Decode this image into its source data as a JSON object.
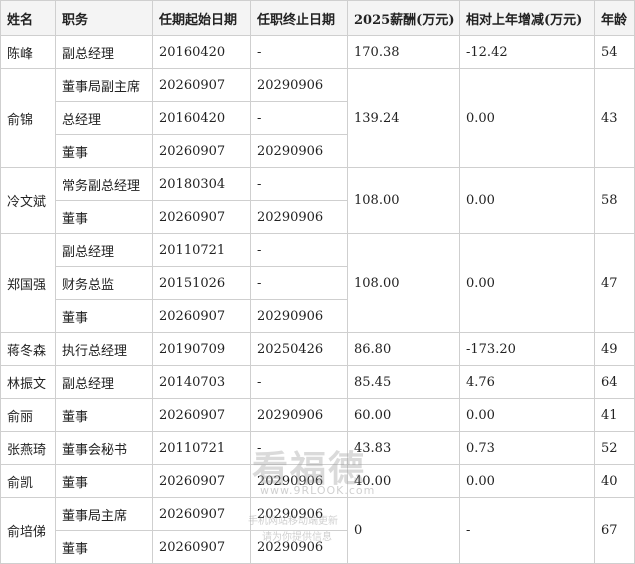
{
  "headers": [
    "姓名",
    "职务",
    "任期起始日期",
    "任职终止日期",
    "2025薪酬(万元)",
    "相对上年增减(万元)",
    "年龄"
  ],
  "people": [
    {
      "name": "陈峰",
      "roles": [
        {
          "title": "副总经理",
          "start": "20160420",
          "end": "-"
        }
      ],
      "salary": "170.38",
      "change": "-12.42",
      "age": "54"
    },
    {
      "name": "俞锦",
      "roles": [
        {
          "title": "董事局副主席",
          "start": "20260907",
          "end": "20290906"
        },
        {
          "title": "总经理",
          "start": "20160420",
          "end": "-"
        },
        {
          "title": "董事",
          "start": "20260907",
          "end": "20290906"
        }
      ],
      "salary": "139.24",
      "change": "0.00",
      "age": "43"
    },
    {
      "name": "冷文斌",
      "roles": [
        {
          "title": "常务副总经理",
          "start": "20180304",
          "end": "-"
        },
        {
          "title": "董事",
          "start": "20260907",
          "end": "20290906"
        }
      ],
      "salary": "108.00",
      "change": "0.00",
      "age": "58"
    },
    {
      "name": "郑国强",
      "roles": [
        {
          "title": "副总经理",
          "start": "20110721",
          "end": "-"
        },
        {
          "title": "财务总监",
          "start": "20151026",
          "end": "-"
        },
        {
          "title": "董事",
          "start": "20260907",
          "end": "20290906"
        }
      ],
      "salary": "108.00",
      "change": "0.00",
      "age": "47"
    },
    {
      "name": "蒋冬森",
      "roles": [
        {
          "title": "执行总经理",
          "start": "20190709",
          "end": "20250426"
        }
      ],
      "salary": "86.80",
      "change": "-173.20",
      "age": "49"
    },
    {
      "name": "林振文",
      "roles": [
        {
          "title": "副总经理",
          "start": "20140703",
          "end": "-"
        }
      ],
      "salary": "85.45",
      "change": "4.76",
      "age": "64"
    },
    {
      "name": "俞丽",
      "roles": [
        {
          "title": "董事",
          "start": "20260907",
          "end": "20290906"
        }
      ],
      "salary": "60.00",
      "change": "0.00",
      "age": "41"
    },
    {
      "name": "张燕琦",
      "roles": [
        {
          "title": "董事会秘书",
          "start": "20110721",
          "end": "-"
        }
      ],
      "salary": "43.83",
      "change": "0.73",
      "age": "52"
    },
    {
      "name": "俞凯",
      "roles": [
        {
          "title": "董事",
          "start": "20260907",
          "end": "20290906"
        }
      ],
      "salary": "40.00",
      "change": "0.00",
      "age": "40"
    },
    {
      "name": "俞培俤",
      "roles": [
        {
          "title": "董事局主席",
          "start": "20260907",
          "end": "20290906"
        },
        {
          "title": "董事",
          "start": "20260907",
          "end": "20290906"
        }
      ],
      "salary": "0",
      "change": "-",
      "age": "67"
    }
  ],
  "watermark": {
    "logo": "看福德",
    "url": "www.9RLOOK.com",
    "line1": "手机网站移动端更新",
    "line2": "请为你提供信息"
  }
}
